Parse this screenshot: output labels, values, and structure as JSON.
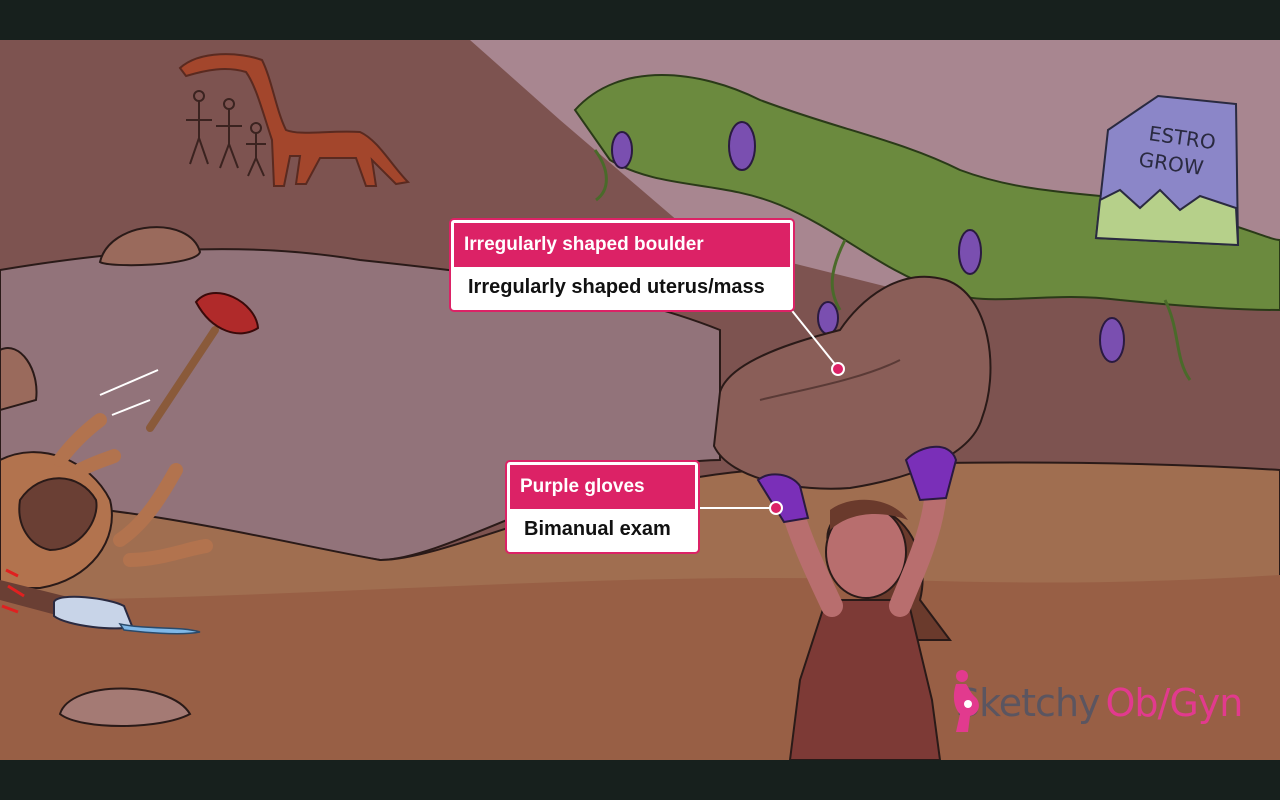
{
  "callouts": {
    "boulder": {
      "caption": "Irregularly shaped boulder",
      "meaning": "Irregularly shaped uterus/mass"
    },
    "gloves": {
      "caption": "Purple gloves",
      "meaning": "Bimanual exam"
    }
  },
  "bag_label": {
    "line1": "ESTRO",
    "line2": "GROW"
  },
  "logo": {
    "part1": "Sketchy",
    "part2": "Ob/Gyn"
  },
  "colors": {
    "accent": "#dc2266",
    "logo_pink": "#e23a8e",
    "glove_purple": "#7a2fb8",
    "letterbox": "#17201d"
  }
}
